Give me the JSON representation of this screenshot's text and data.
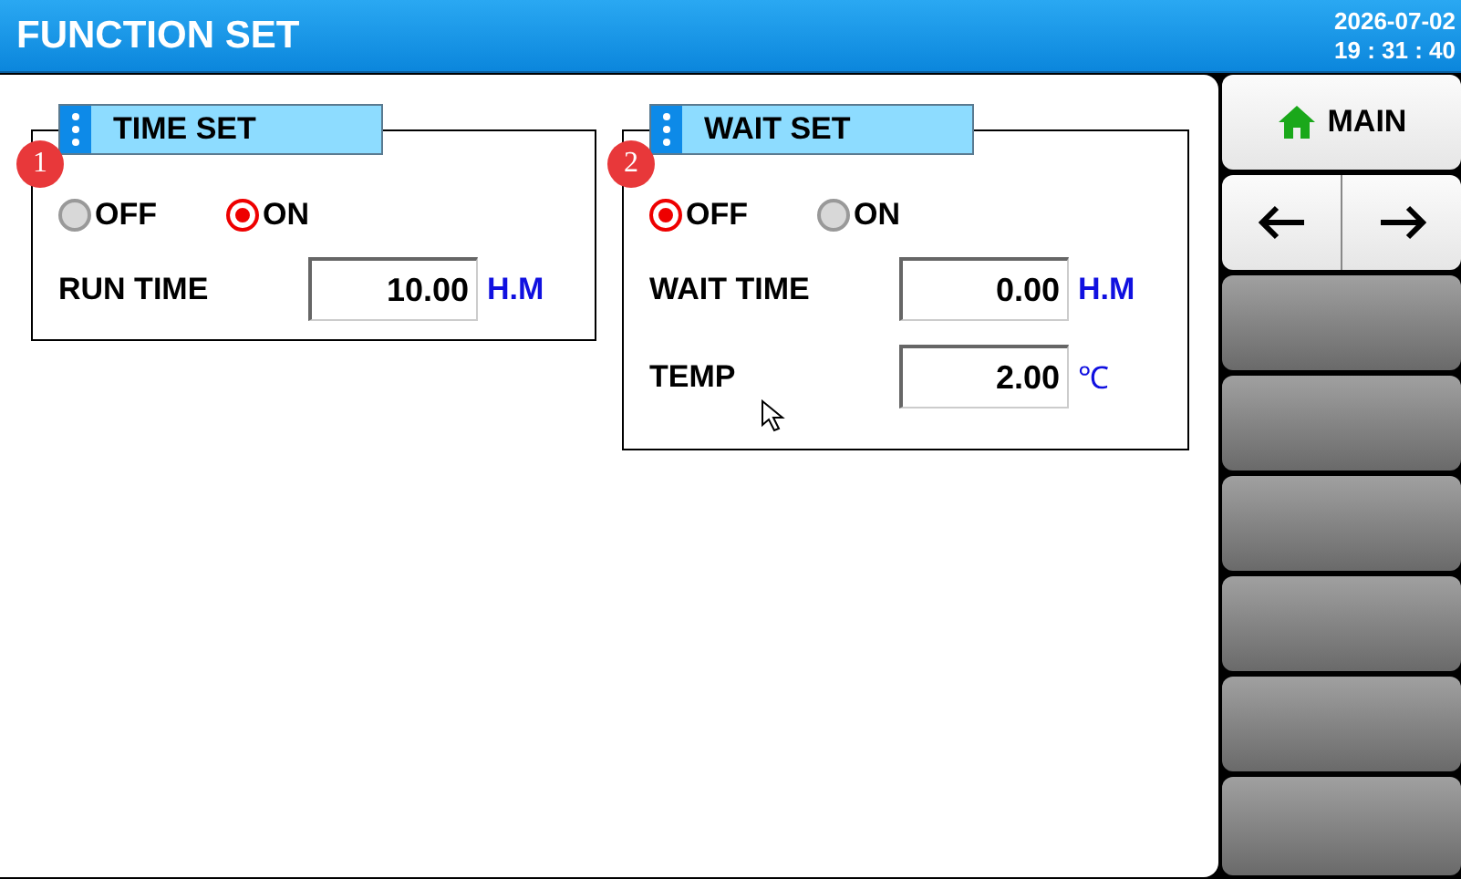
{
  "header": {
    "title": "FUNCTION SET",
    "date": "2026-07-02",
    "time": "19 : 31 : 40"
  },
  "groups": [
    {
      "title": "TIME SET",
      "badge": "1",
      "options": [
        {
          "label": "OFF",
          "selected": false
        },
        {
          "label": "ON",
          "selected": true
        }
      ],
      "fields": [
        {
          "label": "RUN TIME",
          "value": "10.00",
          "unit": "H.M",
          "unit_bold": true
        }
      ]
    },
    {
      "title": "WAIT SET",
      "badge": "2",
      "options": [
        {
          "label": "OFF",
          "selected": true
        },
        {
          "label": "ON",
          "selected": false
        }
      ],
      "fields": [
        {
          "label": "WAIT TIME",
          "value": "0.00",
          "unit": "H.M",
          "unit_bold": true
        },
        {
          "label": "TEMP",
          "value": "2.00",
          "unit": "℃",
          "unit_bold": false
        }
      ]
    }
  ],
  "sidebar": [
    {
      "kind": "home",
      "label": "MAIN"
    },
    {
      "kind": "arrows"
    },
    {
      "kind": "blank"
    },
    {
      "kind": "blank"
    },
    {
      "kind": "blank"
    },
    {
      "kind": "blank"
    },
    {
      "kind": "blank"
    },
    {
      "kind": "blank"
    }
  ]
}
